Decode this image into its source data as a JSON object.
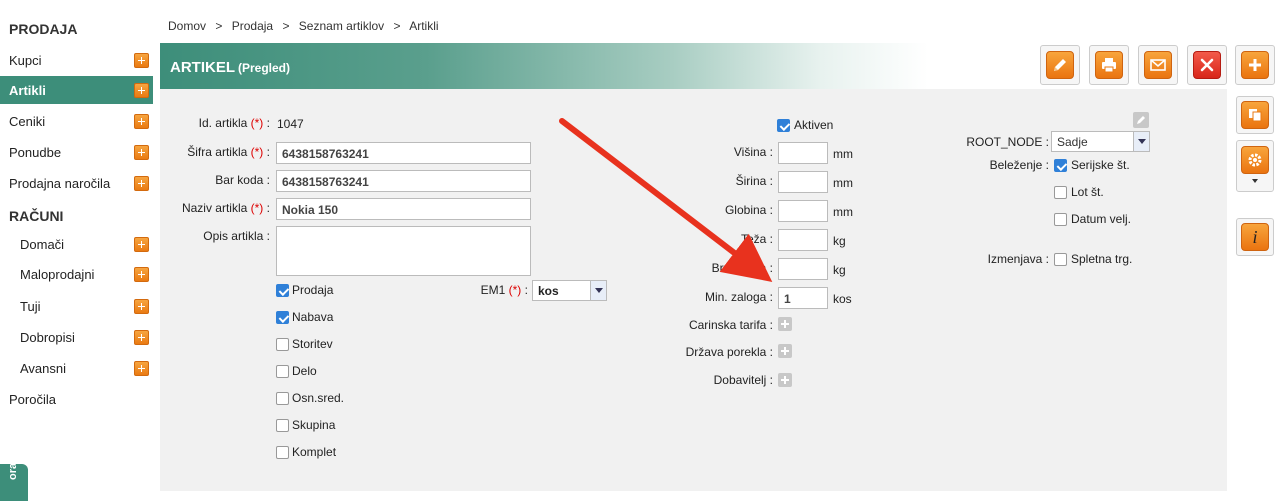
{
  "sidebar": {
    "section_sales": "PRODAJA",
    "items_sales": [
      {
        "label": "Kupci"
      },
      {
        "label": "Artikli"
      },
      {
        "label": "Ceniki"
      },
      {
        "label": "Ponudbe"
      },
      {
        "label": "Prodajna naročila"
      }
    ],
    "section_invoices": "RAČUNI",
    "items_invoices": [
      {
        "label": "Domači"
      },
      {
        "label": "Maloprodajni"
      },
      {
        "label": "Tuji"
      },
      {
        "label": "Dobropisi"
      },
      {
        "label": "Avansni"
      }
    ],
    "reports": "Poročila",
    "side_tab": "ora"
  },
  "breadcrumb": {
    "items": [
      "Domov",
      ">",
      "Prodaja",
      ">",
      "Seznam artiklov",
      ">",
      "Artikli"
    ]
  },
  "header": {
    "title": "ARTIKEL",
    "subtitle": "(Pregled)"
  },
  "form": {
    "id_label": "Id. artikla",
    "req_mark": "(*)",
    "colon": ":",
    "id_value": "1047",
    "sifra_label": "Šifra artikla",
    "sifra_value": "6438158763241",
    "barcode_label": "Bar koda",
    "barcode_value": "6438158763241",
    "name_label": "Naziv artikla",
    "name_value": "Nokia 150",
    "desc_label": "Opis artikla",
    "desc_value": "",
    "em1_label": "EM1",
    "em1_value": "kos",
    "types": [
      {
        "label": "Prodaja",
        "checked": true
      },
      {
        "label": "Nabava",
        "checked": true
      },
      {
        "label": "Storitev",
        "checked": false
      },
      {
        "label": "Delo",
        "checked": false
      },
      {
        "label": "Osn.sred.",
        "checked": false
      },
      {
        "label": "Skupina",
        "checked": false
      },
      {
        "label": "Komplet",
        "checked": false
      }
    ],
    "active_label": "Aktiven",
    "height_label": "Višina :",
    "width_label": "Širina :",
    "depth_label": "Globina :",
    "weight_label": "Teža :",
    "gross_label": "Bruto teža :",
    "minstock_label": "Min. zaloga :",
    "minstock_value": "1",
    "unit_mm": "mm",
    "unit_kg": "kg",
    "unit_kos": "kos",
    "customs_label": "Carinska tarifa :",
    "origin_label": "Država porekla :",
    "supplier_label": "Dobavitelj :",
    "root_label": "ROOT_NODE :",
    "root_value": "Sadje",
    "tracking_label": "Beleženje :",
    "serial_label": "Serijske št.",
    "lot_label": "Lot št.",
    "expiry_label": "Datum velj.",
    "exchange_label": "Izmenjava :",
    "webshop_label": "Spletna trg."
  },
  "colors": {
    "accent": "#3d8e7a",
    "button_orange": "#ea7a12",
    "button_red": "#d8261a",
    "annotation_arrow": "#e8321e"
  }
}
